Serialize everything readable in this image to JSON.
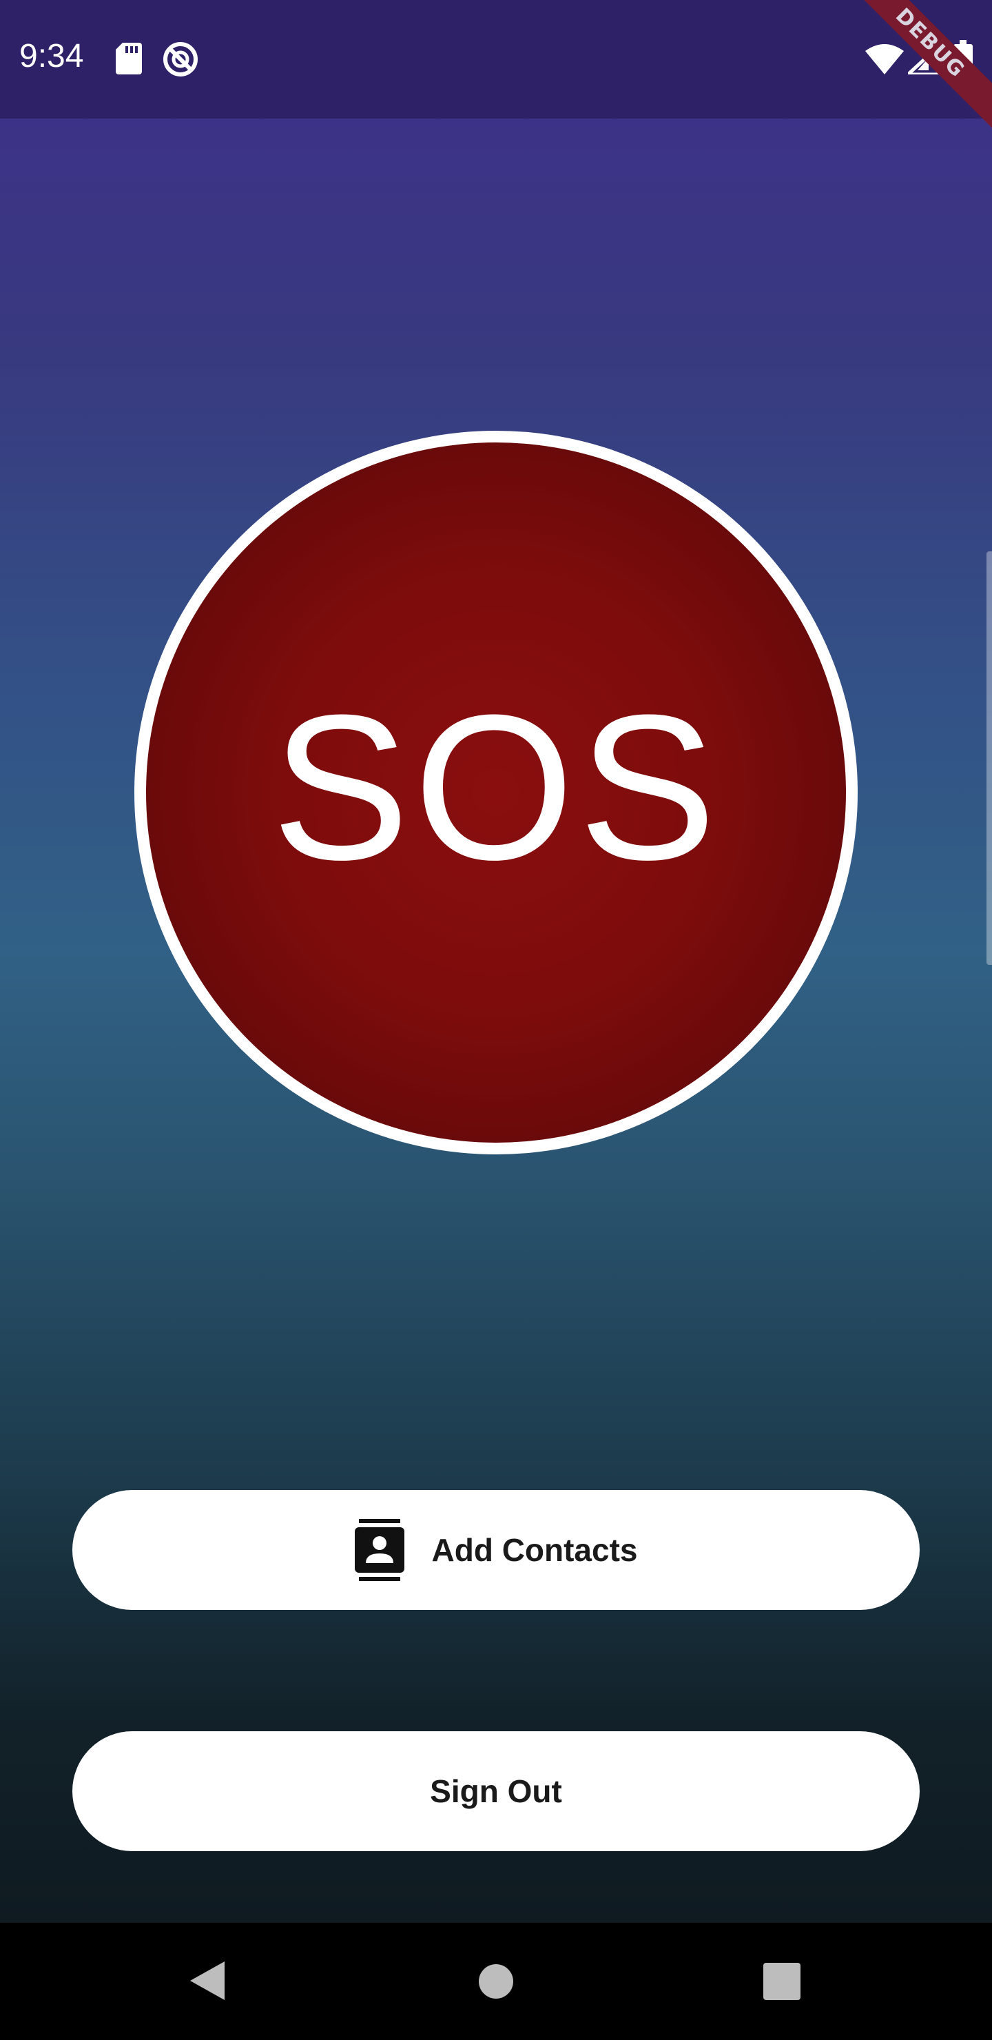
{
  "status_bar": {
    "time": "9:34",
    "icons": [
      "sd-card-icon",
      "no-disturb-icon",
      "wifi-icon",
      "signal-icon",
      "battery-icon"
    ],
    "background": "#2e2167"
  },
  "debug_banner": {
    "label": "DEBUG",
    "color": "#7a1a2e"
  },
  "main": {
    "sos_button": {
      "label": "SOS",
      "fill": "#7d0c0c",
      "ring": "#ffffff"
    },
    "add_contacts_button": {
      "label": "Add Contacts",
      "icon": "contacts-icon"
    },
    "sign_out_button": {
      "label": "Sign Out"
    }
  },
  "nav_bar": {
    "buttons": [
      "back-icon",
      "home-icon",
      "recents-icon"
    ]
  },
  "colors": {
    "gradient_top": "#3f2f8c",
    "gradient_mid": "#316186",
    "gradient_bottom": "#0f1a21"
  }
}
